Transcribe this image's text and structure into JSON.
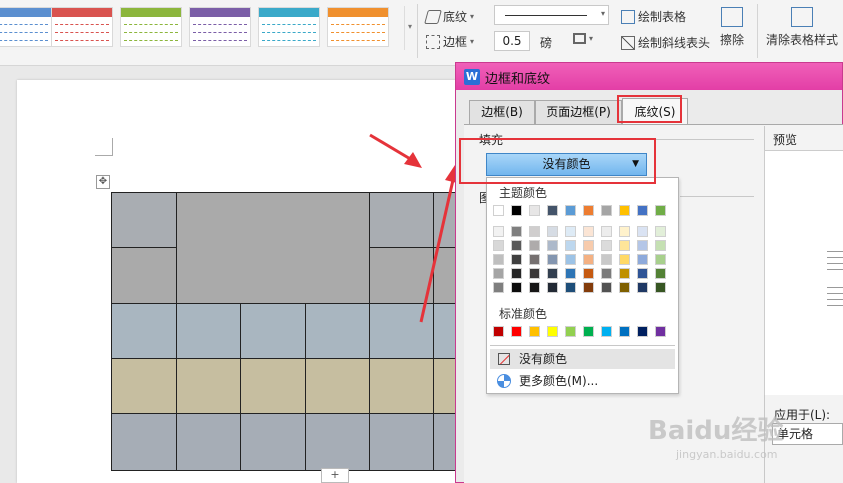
{
  "ribbon": {
    "shading_label": "底纹",
    "border_label": "边框",
    "line_width_value": "0.5",
    "line_width_unit": "磅",
    "draw_table_label": "绘制表格",
    "draw_diagonal_label": "绘制斜线表头",
    "eraser_label": "擦除",
    "clear_style_label": "清除表格样式",
    "style_colors": [
      "#5b8fd0",
      "#d9534f",
      "#8cb63c",
      "#7b5ea7",
      "#3aa9c9",
      "#f0902e"
    ]
  },
  "dialog": {
    "title": "边框和底纹",
    "app_icon": "W",
    "tabs": [
      {
        "label": "边框(B)"
      },
      {
        "label": "页面边框(P)"
      },
      {
        "label": "底纹(S)"
      }
    ],
    "fill_label": "填充",
    "pattern_label_partial": "图",
    "fill_selected": "没有颜色",
    "preview_label": "预览",
    "apply_to_label": "应用于(L):",
    "apply_to_value": "单元格"
  },
  "color_popup": {
    "theme_label": "主题颜色",
    "standard_label": "标准颜色",
    "no_color_label": "没有颜色",
    "more_colors_label": "更多颜色(M)...",
    "theme_top_row": [
      "#ffffff",
      "#000000",
      "#e7e6e6",
      "#44546a",
      "#5b9bd5",
      "#ed7d31",
      "#a5a5a5",
      "#ffc000",
      "#4472c4",
      "#70ad47"
    ],
    "theme_shades": [
      [
        "#f2f2f2",
        "#7f7f7f",
        "#d0cece",
        "#d6dce4",
        "#deebf6",
        "#fbe5d5",
        "#ededed",
        "#fff2cc",
        "#dae3f3",
        "#e2efd9"
      ],
      [
        "#d8d8d8",
        "#595959",
        "#aeabab",
        "#adb9ca",
        "#bdd7ee",
        "#f7cbac",
        "#dbdbdb",
        "#fee599",
        "#b4c6e7",
        "#c5e0b3"
      ],
      [
        "#bfbfbf",
        "#3f3f3f",
        "#757070",
        "#8496b0",
        "#9dc3e6",
        "#f4b183",
        "#c9c9c9",
        "#ffd966",
        "#8eaadb",
        "#a8d08d"
      ],
      [
        "#a5a5a5",
        "#262626",
        "#3a3838",
        "#323f4f",
        "#2e75b5",
        "#c55a11",
        "#7b7b7b",
        "#bf9000",
        "#2f5496",
        "#538135"
      ],
      [
        "#7f7f7f",
        "#0c0c0c",
        "#171616",
        "#222a35",
        "#1e4e79",
        "#833c0b",
        "#525252",
        "#7f6000",
        "#1f3864",
        "#375623"
      ]
    ],
    "standard_colors": [
      "#c00000",
      "#ff0000",
      "#ffc000",
      "#ffff00",
      "#92d050",
      "#00b050",
      "#00b0f0",
      "#0070c0",
      "#002060",
      "#7030a0"
    ]
  },
  "table": {
    "colors": {
      "gray_dark": "#a9adb2",
      "gray_mid": "#aaaaaa",
      "blue_gray": "#a9b6c0",
      "tan": "#c6bea0",
      "slate": "#a6adb6"
    }
  },
  "document": {
    "add_row_symbol": "+",
    "move_handle_symbol": "✥"
  },
  "accent": {
    "highlight_red": "#e5333a",
    "titlebar_pink": "#e844aa"
  },
  "watermark": {
    "brand": "Baidu经验",
    "url": "jingyan.baidu.com"
  }
}
